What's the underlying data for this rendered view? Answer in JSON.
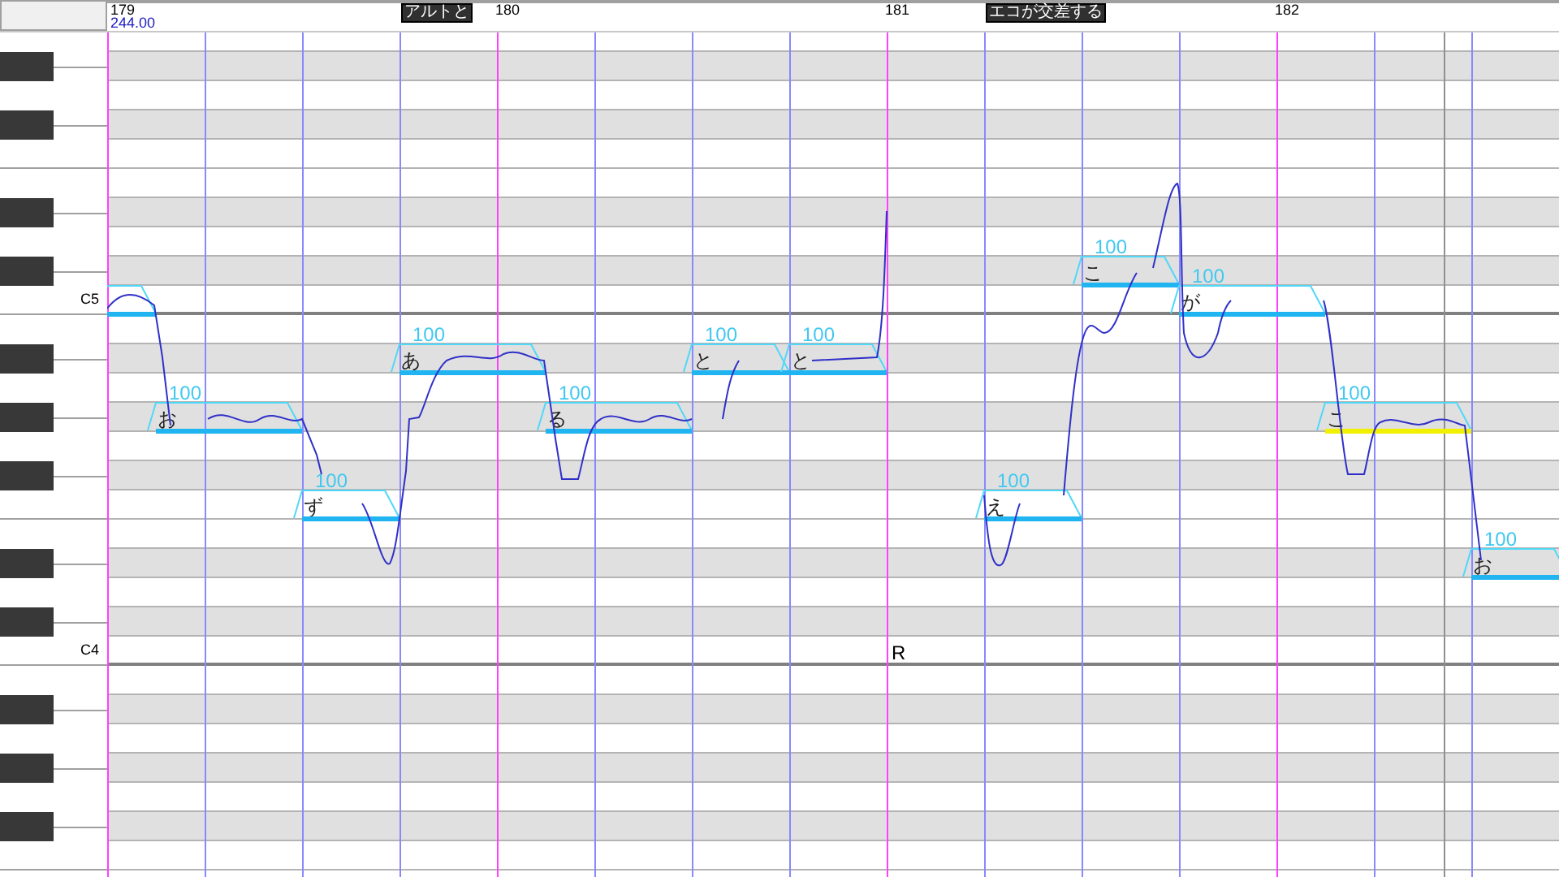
{
  "ruler": {
    "bars": [
      "179",
      "180",
      "181",
      "182"
    ],
    "tempo": "244.00",
    "flags": [
      "アルトと",
      "エコが交差する"
    ]
  },
  "keyboard": {
    "labels": [
      "C5",
      "C4"
    ]
  },
  "notes": [
    {
      "kind": "note",
      "selected": false
    },
    {
      "kind": "note",
      "lyric": "お",
      "intensity": "100",
      "selected": false
    },
    {
      "kind": "note",
      "lyric": "ず",
      "intensity": "100",
      "selected": false
    },
    {
      "kind": "note",
      "lyric": "あ",
      "intensity": "100",
      "selected": false
    },
    {
      "kind": "note",
      "lyric": "る",
      "intensity": "100",
      "selected": false
    },
    {
      "kind": "note",
      "lyric": "と",
      "intensity": "100",
      "selected": false
    },
    {
      "kind": "note",
      "lyric": "と",
      "intensity": "100",
      "selected": false
    },
    {
      "kind": "rest",
      "lyric": "R"
    },
    {
      "kind": "note",
      "lyric": "え",
      "intensity": "100",
      "selected": false
    },
    {
      "kind": "note",
      "lyric": "こ",
      "intensity": "100",
      "selected": false
    },
    {
      "kind": "note",
      "lyric": "が",
      "intensity": "100",
      "selected": false
    },
    {
      "kind": "note",
      "lyric": "こ",
      "intensity": "100",
      "selected": true
    },
    {
      "kind": "note",
      "lyric": "お",
      "intensity": "100",
      "selected": false
    }
  ]
}
